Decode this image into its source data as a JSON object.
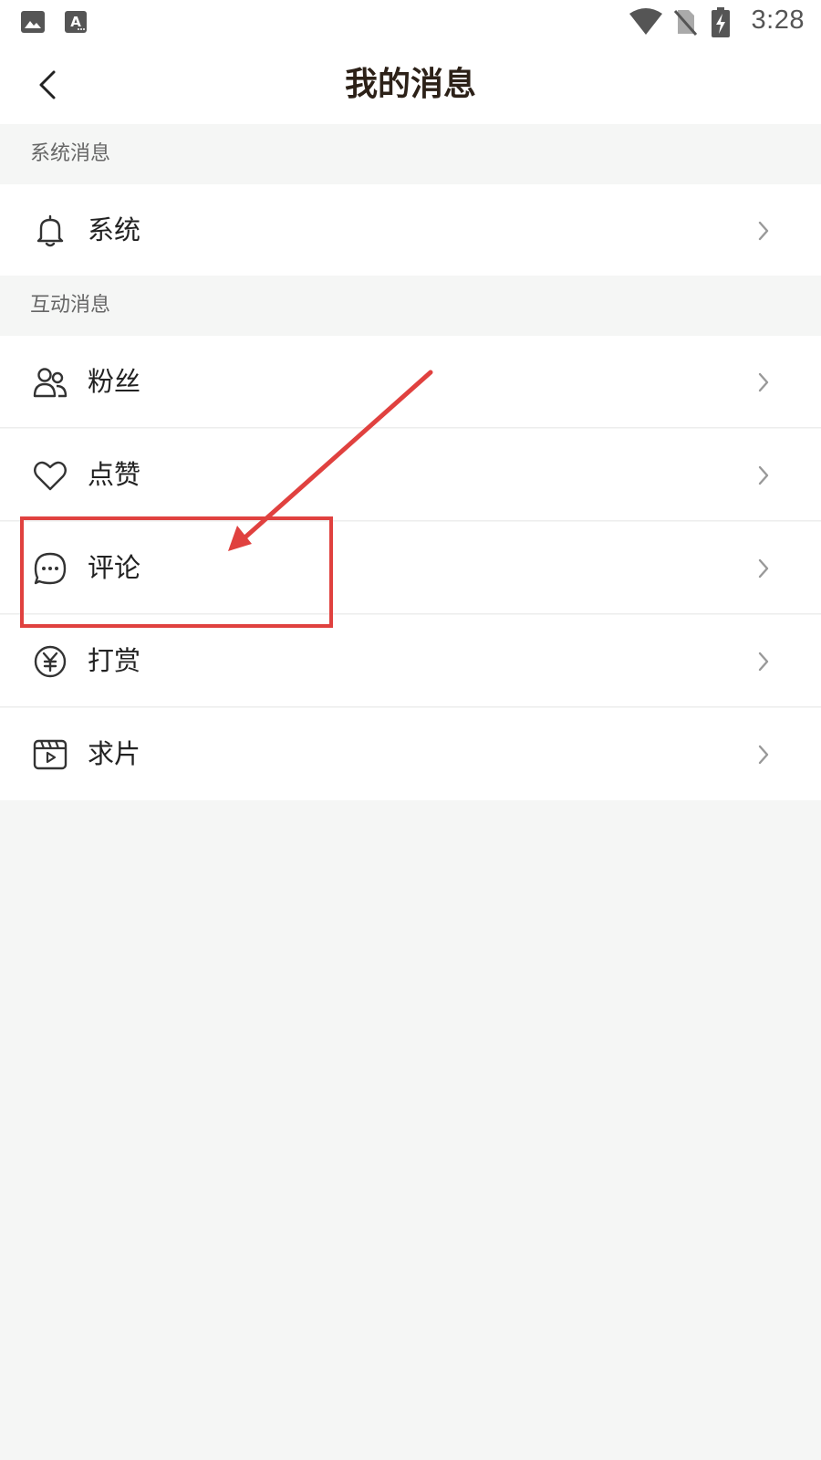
{
  "status_bar": {
    "time": "3:28",
    "left_icons": [
      "image-icon",
      "text-a-icon"
    ],
    "right_icons": [
      "wifi-icon",
      "no-sim-icon",
      "battery-charging-icon"
    ]
  },
  "header": {
    "title": "我的消息",
    "back_icon": "chevron-left-icon"
  },
  "sections": [
    {
      "title": "系统消息",
      "items": [
        {
          "label": "系统",
          "icon": "bell-icon"
        }
      ]
    },
    {
      "title": "互动消息",
      "items": [
        {
          "label": "粉丝",
          "icon": "users-icon"
        },
        {
          "label": "点赞",
          "icon": "heart-icon"
        },
        {
          "label": "评论",
          "icon": "comment-icon"
        },
        {
          "label": "打赏",
          "icon": "yen-icon"
        },
        {
          "label": "求片",
          "icon": "film-icon"
        }
      ]
    }
  ],
  "annotation": {
    "color": "#e0413f",
    "target": "评论"
  },
  "colors": {
    "background": "#f5f6f5",
    "surface": "#ffffff",
    "title": "#2c2118",
    "section_text": "#666666",
    "annotation_red": "#e0413f"
  }
}
